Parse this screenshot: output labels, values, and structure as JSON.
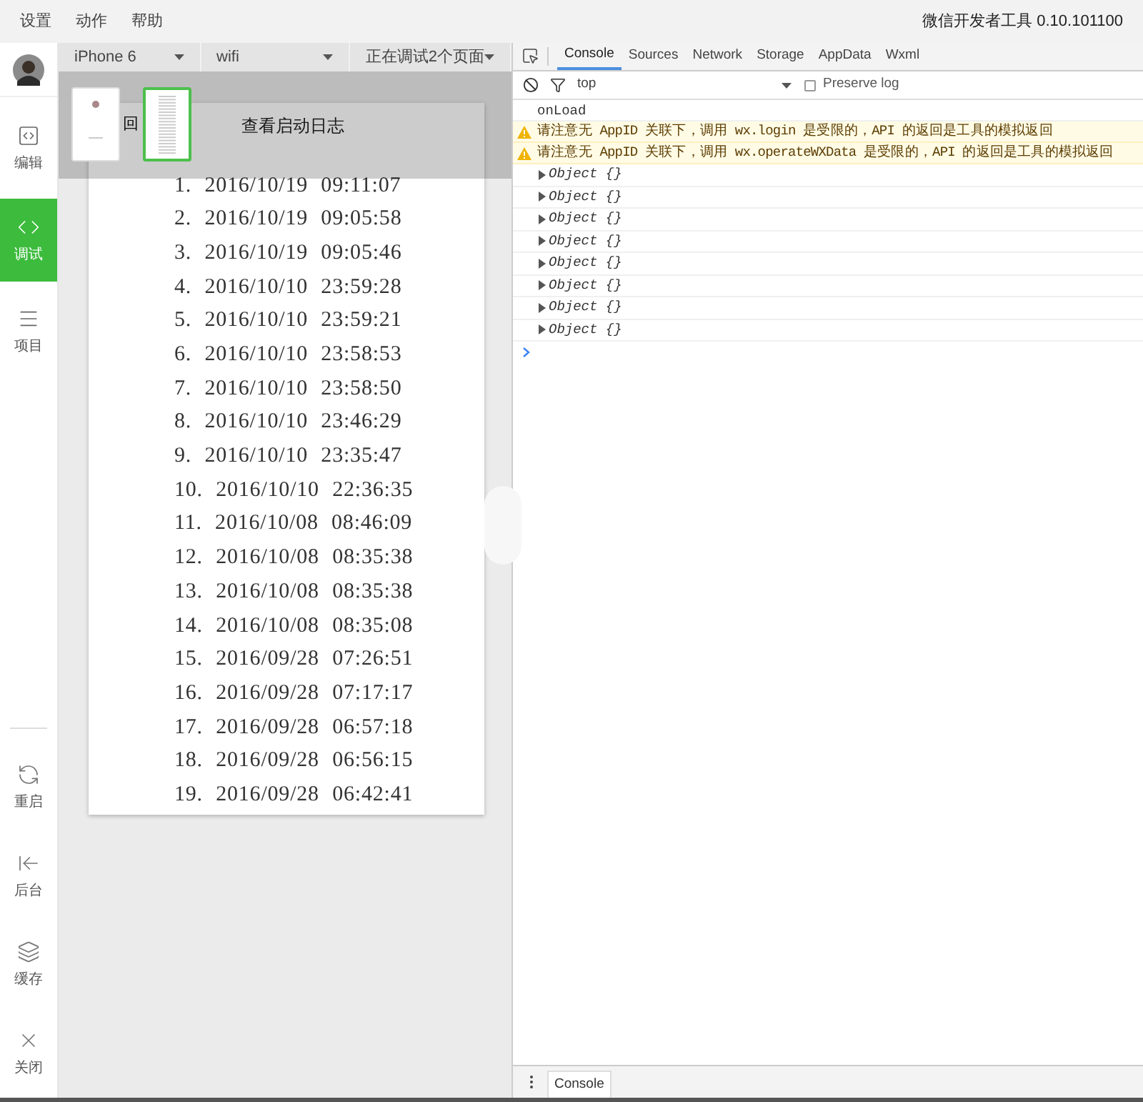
{
  "menu": {
    "items": [
      "设置",
      "动作",
      "帮助"
    ],
    "app_title": "微信开发者工具 0.10.101100"
  },
  "sidebar": {
    "items": [
      {
        "kind": "edit",
        "label": "编辑",
        "selected": false
      },
      {
        "kind": "debug",
        "label": "调试",
        "selected": true
      },
      {
        "kind": "project",
        "label": "项目",
        "selected": false
      }
    ],
    "bottom_items": [
      {
        "kind": "restart",
        "label": "重启"
      },
      {
        "kind": "background",
        "label": "后台"
      },
      {
        "kind": "cache",
        "label": "缓存"
      },
      {
        "kind": "close",
        "label": "关闭"
      }
    ]
  },
  "simulator": {
    "toolbar": [
      "iPhone 6",
      "wifi",
      "正在调试2个页面"
    ],
    "page_thumbnails": [
      {
        "selected": false
      },
      {
        "selected": true
      }
    ],
    "page": {
      "back": "回",
      "title": "查看启动日志",
      "log": [
        {
          "number": "1.",
          "time": "2016/10/19 09:11:07"
        },
        {
          "number": "2.",
          "time": "2016/10/19 09:05:58"
        },
        {
          "number": "3.",
          "time": "2016/10/19 09:05:46"
        },
        {
          "number": "4.",
          "time": "2016/10/10 23:59:28"
        },
        {
          "number": "5.",
          "time": "2016/10/10 23:59:21"
        },
        {
          "number": "6.",
          "time": "2016/10/10 23:58:53"
        },
        {
          "number": "7.",
          "time": "2016/10/10 23:58:50"
        },
        {
          "number": "8.",
          "time": "2016/10/10 23:46:29"
        },
        {
          "number": "9.",
          "time": "2016/10/10 23:35:47"
        },
        {
          "number": "10.",
          "time": "2016/10/10 22:36:35"
        },
        {
          "number": "11.",
          "time": "2016/10/08 08:46:09"
        },
        {
          "number": "12.",
          "time": "2016/10/08 08:35:38"
        },
        {
          "number": "13.",
          "time": "2016/10/08 08:35:38"
        },
        {
          "number": "14.",
          "time": "2016/10/08 08:35:08"
        },
        {
          "number": "15.",
          "time": "2016/09/28 07:26:51"
        },
        {
          "number": "16.",
          "time": "2016/09/28 07:17:17"
        },
        {
          "number": "17.",
          "time": "2016/09/28 06:57:18"
        },
        {
          "number": "18.",
          "time": "2016/09/28 06:56:15"
        },
        {
          "number": "19.",
          "time": "2016/09/28 06:42:41"
        }
      ]
    }
  },
  "devtools": {
    "tabs": [
      {
        "label": "Console",
        "selected": true
      },
      {
        "label": "Sources",
        "selected": false
      },
      {
        "label": "Network",
        "selected": false
      },
      {
        "label": "Storage",
        "selected": false
      },
      {
        "label": "AppData",
        "selected": false
      },
      {
        "label": "Wxml",
        "selected": false
      }
    ],
    "context": "top",
    "preserve_log": {
      "label": "Preserve log",
      "checked": false
    },
    "console": [
      {
        "kind": "log",
        "text": "onLoad"
      },
      {
        "kind": "warning",
        "text": "请注意无 AppID 关联下，调用 wx.login 是受限的，API 的返回是工具的模拟返回"
      },
      {
        "kind": "warning",
        "text": "请注意无 AppID 关联下，调用 wx.operateWXData 是受限的，API 的返回是工具的模拟返回"
      },
      {
        "kind": "object",
        "text": "Object {}"
      },
      {
        "kind": "object",
        "text": "Object {}"
      },
      {
        "kind": "object",
        "text": "Object {}"
      },
      {
        "kind": "object",
        "text": "Object {}"
      },
      {
        "kind": "object",
        "text": "Object {}"
      },
      {
        "kind": "object",
        "text": "Object {}"
      },
      {
        "kind": "object",
        "text": "Object {}"
      },
      {
        "kind": "object",
        "text": "Object {}"
      }
    ],
    "drawer_tabs": [
      "Console"
    ]
  }
}
